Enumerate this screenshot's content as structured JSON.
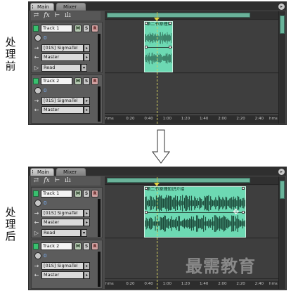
{
  "labels": {
    "before": [
      "处",
      "理",
      "前"
    ],
    "after": [
      "处",
      "理",
      "后"
    ]
  },
  "panels": [
    {
      "id": "before",
      "tabs": {
        "main": "Main",
        "mixer": "Mixer"
      },
      "panel_menu_icon": "chevron-right-icon",
      "toolbar_icons": [
        "swap-arrows-icon",
        "fx-icon",
        "send-routing-icon",
        "eq-bars-icon"
      ],
      "tracks": [
        {
          "name": "Track 1",
          "m": "M",
          "s": "S",
          "r": "R",
          "volume": "0",
          "input": "[01S] SigmaTel",
          "output": "Master",
          "automation": "Read"
        },
        {
          "name": "Track 2",
          "m": "M",
          "s": "S",
          "r": "R",
          "volume": "0",
          "input": "[01S] SigmaTel",
          "output": "Master"
        }
      ],
      "clip": {
        "title": "第二节原理知识介绍",
        "start_time": "0:40",
        "end_time": "1:00"
      },
      "ruler": [
        "hms",
        "0:20",
        "0:40",
        "1:00",
        "1:20",
        "1:40",
        "2:00",
        "2:20",
        "2:40",
        "hms"
      ],
      "overview_fill": 0.82
    },
    {
      "id": "after",
      "tabs": {
        "main": "Main",
        "mixer": "Mixer"
      },
      "panel_menu_icon": "chevron-right-icon",
      "toolbar_icons": [
        "swap-arrows-icon",
        "fx-icon",
        "send-routing-icon",
        "eq-bars-icon"
      ],
      "tracks": [
        {
          "name": "Track 1",
          "m": "M",
          "s": "S",
          "r": "R",
          "volume": "0",
          "input": "[01S] SigmaTel",
          "output": "Master",
          "automation": "Read"
        },
        {
          "name": "Track 2",
          "m": "M",
          "s": "S",
          "r": "R",
          "volume": "0",
          "input": "[01S] SigmaTel",
          "output": "Master"
        }
      ],
      "clip": {
        "title": "第二节原理知识介绍",
        "start_time": "0:40",
        "end_time": "2:20"
      },
      "ruler": [
        "hms",
        "0:20",
        "0:40",
        "1:00",
        "1:20",
        "1:40",
        "2:00",
        "2:20",
        "2:40",
        "hms"
      ],
      "overview_fill": 0.82
    }
  ],
  "watermark": "最需教育",
  "colors": {
    "clip": "#6dd9b3",
    "waveform": "#1c4a3a",
    "playhead": "#d4cf62",
    "panel_bg": "#4a4a4a"
  }
}
